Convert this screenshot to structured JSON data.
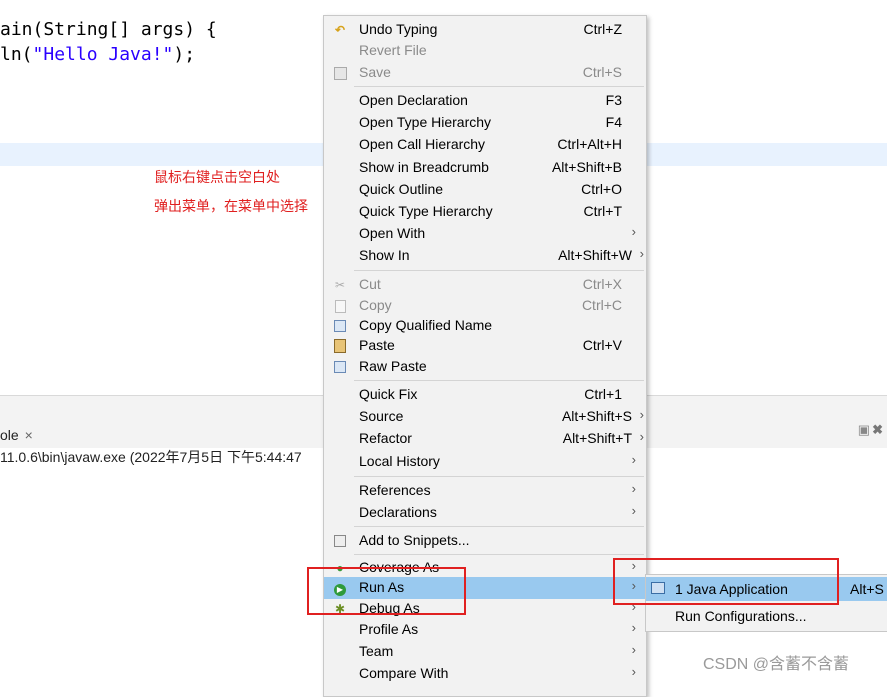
{
  "editor": {
    "code_line_1": "ain(String[] args) {",
    "code_line_2_pre": "ln(",
    "code_line_2_str": "\"Hello Java!\"",
    "code_line_2_post": ");"
  },
  "annotation": {
    "line_1": "鼠标右键点击空白处",
    "line_2": "弹出菜单，在菜单中选择"
  },
  "console_panel": {
    "tab_label": "ole",
    "tab_close": "×",
    "launch_info": "11.0.6\\bin\\javaw.exe  (2022年7月5日 下午5:44:47"
  },
  "context_menu": {
    "items": [
      {
        "label": "Undo Typing",
        "shortcut": "Ctrl+Z",
        "icon": "undo-icon"
      },
      {
        "label": "Revert File",
        "shortcut": "",
        "disabled": true
      },
      {
        "label": "Save",
        "shortcut": "Ctrl+S",
        "icon": "save-icon",
        "disabled": true
      },
      {
        "label": "Open Declaration",
        "shortcut": "F3"
      },
      {
        "label": "Open Type Hierarchy",
        "shortcut": "F4"
      },
      {
        "label": "Open Call Hierarchy",
        "shortcut": "Ctrl+Alt+H"
      },
      {
        "label": "Show in Breadcrumb",
        "shortcut": "Alt+Shift+B"
      },
      {
        "label": "Quick Outline",
        "shortcut": "Ctrl+O"
      },
      {
        "label": "Quick Type Hierarchy",
        "shortcut": "Ctrl+T"
      },
      {
        "label": "Open With",
        "submenu": true
      },
      {
        "label": "Show In",
        "shortcut": "Alt+Shift+W",
        "submenu": true
      },
      {
        "label": "Cut",
        "shortcut": "Ctrl+X",
        "icon": "cut-icon",
        "disabled": true
      },
      {
        "label": "Copy",
        "shortcut": "Ctrl+C",
        "icon": "copy-icon",
        "disabled": true
      },
      {
        "label": "Copy Qualified Name",
        "icon": "copy-qualified-icon"
      },
      {
        "label": "Paste",
        "shortcut": "Ctrl+V",
        "icon": "paste-icon"
      },
      {
        "label": "Raw Paste",
        "icon": "raw-paste-icon"
      },
      {
        "label": "Quick Fix",
        "shortcut": "Ctrl+1"
      },
      {
        "label": "Source",
        "shortcut": "Alt+Shift+S",
        "submenu": true
      },
      {
        "label": "Refactor",
        "shortcut": "Alt+Shift+T",
        "submenu": true
      },
      {
        "label": "Local History",
        "submenu": true
      },
      {
        "label": "References",
        "submenu": true
      },
      {
        "label": "Declarations",
        "submenu": true
      },
      {
        "label": "Add to Snippets...",
        "icon": "snippets-icon"
      },
      {
        "label": "Coverage As",
        "icon": "coverage-icon",
        "submenu": true
      },
      {
        "label": "Run As",
        "icon": "run-icon",
        "submenu": true,
        "highlighted": true
      },
      {
        "label": "Debug As",
        "icon": "debug-icon",
        "submenu": true
      },
      {
        "label": "Profile As",
        "submenu": true
      },
      {
        "label": "Team",
        "submenu": true
      },
      {
        "label": "Compare With",
        "submenu": true
      }
    ]
  },
  "run_as_submenu": {
    "items": [
      {
        "label": "1 Java Application",
        "shortcut": "Alt+S",
        "icon": "java-app-icon",
        "highlighted": true
      },
      {
        "label": "Run Configurations..."
      }
    ]
  },
  "watermark": "CSDN @含蓄不含蓄",
  "colors": {
    "highlight": "#99c9ef",
    "annotation_red": "#e02020",
    "string_blue": "#2a00ff",
    "menu_bg": "#f2f2f2"
  }
}
